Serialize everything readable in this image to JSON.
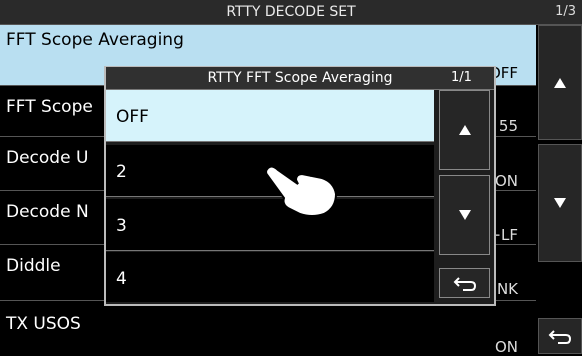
{
  "header": {
    "title": "RTTY DECODE SET",
    "page": "1/3"
  },
  "rows": [
    {
      "label": "FFT Scope Averaging",
      "value": "OFF"
    },
    {
      "label": "FFT Scope",
      "value": "55"
    },
    {
      "label": "Decode U",
      "value": "ON"
    },
    {
      "label": "Decode N",
      "value": "+LF"
    },
    {
      "label": "Diddle",
      "value": "NK"
    },
    {
      "label": "TX USOS",
      "value": "ON"
    }
  ],
  "popup": {
    "title": "RTTY FFT Scope Averaging",
    "page": "1/1",
    "options": [
      "OFF",
      "2",
      "3",
      "4"
    ]
  },
  "icons": {
    "hand": "pointing-hand-icon",
    "up": "arrow-up-icon",
    "down": "arrow-down-icon",
    "back": "back-icon"
  }
}
